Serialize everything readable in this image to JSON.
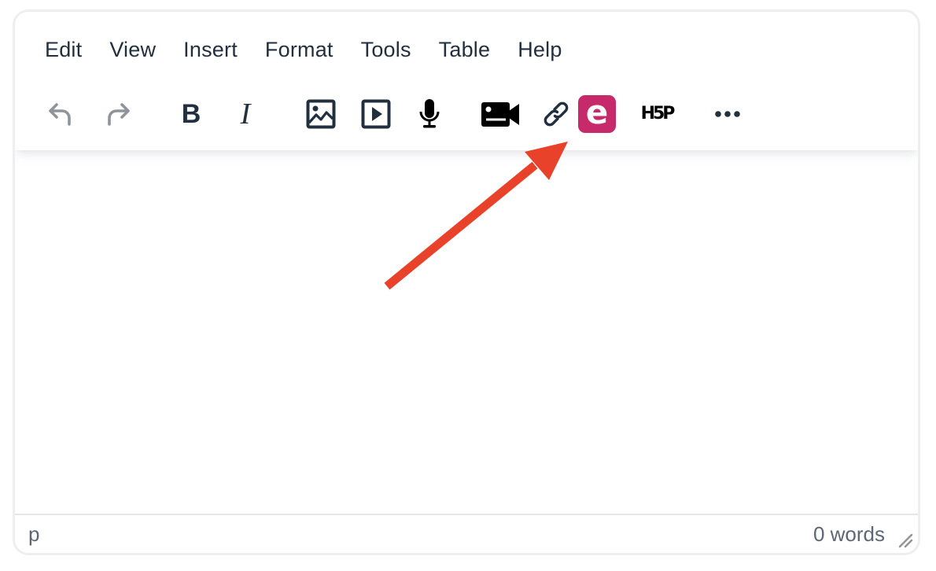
{
  "menubar": {
    "items": [
      {
        "label": "Edit"
      },
      {
        "label": "View"
      },
      {
        "label": "Insert"
      },
      {
        "label": "Format"
      },
      {
        "label": "Tools"
      },
      {
        "label": "Table"
      },
      {
        "label": "Help"
      }
    ]
  },
  "toolbar": {
    "buttons": [
      {
        "name": "undo",
        "icon": "undo-icon",
        "enabled": false
      },
      {
        "name": "redo",
        "icon": "redo-icon",
        "enabled": false
      },
      {
        "name": "bold",
        "icon": "bold-icon",
        "glyph": "B"
      },
      {
        "name": "italic",
        "icon": "italic-icon",
        "glyph": "I"
      },
      {
        "name": "insert-image",
        "icon": "image-icon"
      },
      {
        "name": "insert-media",
        "icon": "media-play-icon"
      },
      {
        "name": "record-audio",
        "icon": "microphone-icon"
      },
      {
        "name": "record-video",
        "icon": "video-camera-icon"
      },
      {
        "name": "insert-link",
        "icon": "link-icon"
      },
      {
        "name": "e-plugin",
        "icon": "e-plugin-icon",
        "glyph": "e",
        "color": "#c62a6b"
      },
      {
        "name": "h5p",
        "icon": "h5p-icon",
        "glyph": "H5P"
      },
      {
        "name": "more",
        "icon": "more-icon"
      }
    ]
  },
  "statusbar": {
    "path": "p",
    "word_count": "0 words"
  },
  "colors": {
    "text": "#222f3e",
    "disabled": "#8f949a",
    "accent_e": "#c62a6b",
    "annotation_arrow": "#e8432a",
    "status_text": "#5d6773"
  }
}
